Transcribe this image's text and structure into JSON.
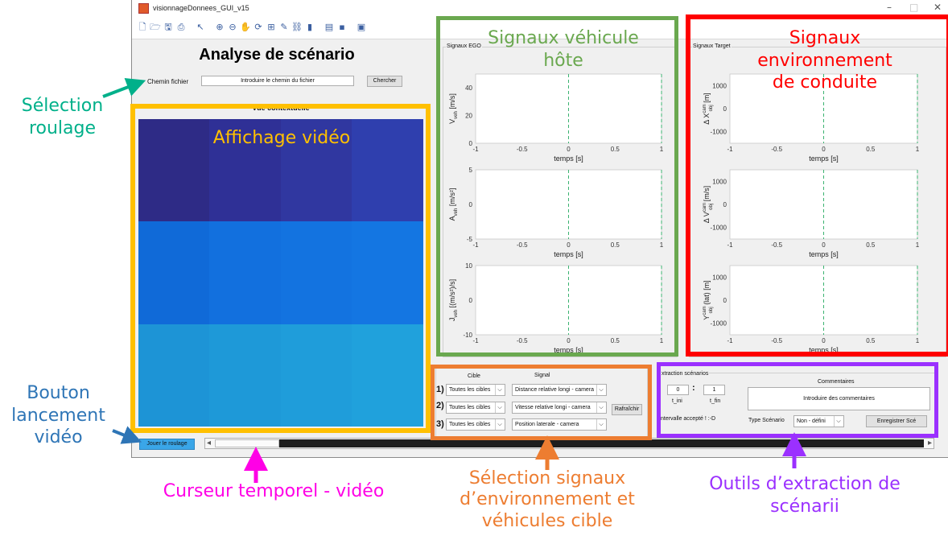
{
  "window": {
    "title": "visionnageDonnees_GUI_v15",
    "controls": [
      "–",
      "□",
      "✕"
    ]
  },
  "toolbar": {
    "icons": [
      "new-icon",
      "open-icon",
      "save-icon",
      "print-icon",
      "cursor-icon",
      "zoom-in-icon",
      "zoom-out-icon",
      "pan-icon",
      "rotate-icon",
      "datatip-icon",
      "brush-icon",
      "link-icon",
      "colorbar-icon",
      "legend-icon",
      "hide-icon",
      "show-icon"
    ]
  },
  "header": {
    "title": "Analyse de scénario",
    "path_label": "Chemin  fichier",
    "path_value": "Introduire le chemin du fichier",
    "browse_label": "Chercher",
    "video_title": "Vue contextuelle"
  },
  "ego_panel": {
    "title": "Signaux EGO",
    "plots": [
      {
        "ylabel": "V",
        "ysub": "veh",
        "yunit": " [m/s]",
        "yticks": [
          "40",
          "20",
          "0"
        ],
        "ymin": 0,
        "ymax": 50
      },
      {
        "ylabel": "A",
        "ysub": "veh",
        "yunit": " [m/s²]",
        "yticks": [
          "5",
          "0",
          "-5"
        ],
        "ymin": -5,
        "ymax": 5
      },
      {
        "ylabel": "J",
        "ysub": "veh",
        "yunit": " [(m/s²)/s]",
        "yticks": [
          "10",
          "0",
          "-10"
        ],
        "ymin": -10,
        "ymax": 10
      }
    ]
  },
  "target_panel": {
    "title": "Signaux Target",
    "plots": [
      {
        "ylabel": "Δ X",
        "ysub": "obj",
        "ysup": "cam",
        "yunit": " [m]",
        "yticks": [
          "1000",
          "0",
          "-1000"
        ],
        "ymin": -1500,
        "ymax": 1500
      },
      {
        "ylabel": "Δ V",
        "ysub": "obj",
        "ysup": "cam",
        "yunit": " [m/s]",
        "yticks": [
          "1000",
          "0",
          "-1000"
        ],
        "ymin": -1500,
        "ymax": 1500
      },
      {
        "ylabel": "Y",
        "ysub": "obj",
        "ysup": "cam",
        "yunit": " (lat) [m]",
        "yticks": [
          "1000",
          "0",
          "-1000"
        ],
        "ymin": -1500,
        "ymax": 1500
      }
    ]
  },
  "xaxis": {
    "label": "temps [s]",
    "ticks": [
      "-1",
      "-0.5",
      "0",
      "0.5",
      "1"
    ],
    "xlim": [
      -1,
      1
    ],
    "cursor_x": 0
  },
  "selection": {
    "col_cible": "Cible",
    "col_signal": "Signal",
    "rows": [
      {
        "num": "1)",
        "cible": "Toutes les cibles",
        "signal": "Distance relative longi - camera"
      },
      {
        "num": "2)",
        "cible": "Toutes les cibles",
        "signal": "Vitesse relative longi - camera"
      },
      {
        "num": "3)",
        "cible": "Toutes les cibles",
        "signal": "Position laterale - camera"
      }
    ],
    "refresh_label": "Rafraîchir"
  },
  "extraction": {
    "title": "xtraction scénarios",
    "t_ini_value": "0",
    "separator": ":",
    "t_fin_value": "1",
    "t_ini_label": "t_ini",
    "t_fin_label": "t_fin",
    "interval_text": "ntervalle accepté ! :-D",
    "comments_title": "Commentaires",
    "comments_placeholder": "Introduire des commentaires",
    "type_label": "Type Scénario",
    "type_value": "Non - défini",
    "save_label": "Enregistrer Scé"
  },
  "playback": {
    "play_label": "Jouer le roulage",
    "left_arrow": "◂",
    "right_arrow": "▸",
    "slider_position": 0
  },
  "video": {
    "tiles": [
      [
        "#2e2b86",
        "#2f3096",
        "#3037a0",
        "#2f3fae"
      ],
      [
        "#106ad8",
        "#1270de",
        "#1373e0",
        "#1476e2"
      ],
      [
        "#1d94d6",
        "#1e99d8",
        "#1f9dda",
        "#20a1dc"
      ]
    ]
  },
  "annotations": {
    "selection_roulage": "Sélection\nroulage",
    "affichage_video": "Affichage vidéo",
    "signaux_vehicule": "Signaux véhicule\nhôte",
    "signaux_env": "Signaux\nenvironnement\nde conduite",
    "bouton_lancement": "Bouton\nlancement\nvidéo",
    "curseur": "Curseur temporel - vidéo",
    "selection_signaux": "Sélection signaux\nd’environnement et\nvéhicules cible",
    "outils_extraction": "Outils d’extraction de\nscénarii"
  },
  "colors": {
    "green": "#6aa84f",
    "red": "#ff0000",
    "yellow": "#ffc000",
    "orange": "#ed7d31",
    "purple": "#9b30ff",
    "teal": "#00b08a",
    "blue": "#2e75b6",
    "magenta": "#ff00e6"
  }
}
